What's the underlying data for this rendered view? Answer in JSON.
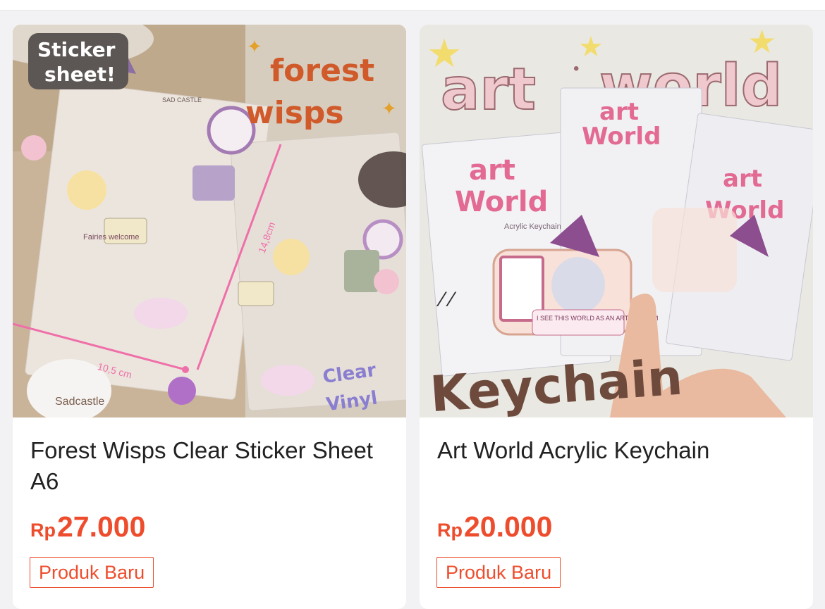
{
  "products": [
    {
      "name": "Forest Wisps Clear Sticker Sheet A6",
      "price_currency": "Rp",
      "price_amount": "27.000",
      "badge": "Produk Baru",
      "image_text": {
        "sticker_sheet": "Sticker",
        "sticker_sheet2": "sheet!",
        "title1": "forest",
        "title2": "wisps",
        "brand_top": "SAD CASTLE",
        "height_label": "14,8cm",
        "width_label": "10,5 cm",
        "clear": "Clear",
        "vinyl": "Vinyl",
        "watermark": "Sadcastle",
        "fairies": "Fairies welcome"
      }
    },
    {
      "name": "Art World Acrylic Keychain",
      "price_currency": "Rp",
      "price_amount": "20.000",
      "badge": "Produk Baru",
      "image_text": {
        "title_art": "art",
        "title_world": "world",
        "keychain": "Keychain",
        "card_art": "art",
        "card_world": "World",
        "card_sub": "Acrylic Keychain",
        "speech": "I SEE THIS WORLD AS AN ART MUSEUM"
      }
    }
  ],
  "colors": {
    "price": "#ee4d2d",
    "badge_border": "#ee4d2d",
    "name_text": "#222222"
  }
}
